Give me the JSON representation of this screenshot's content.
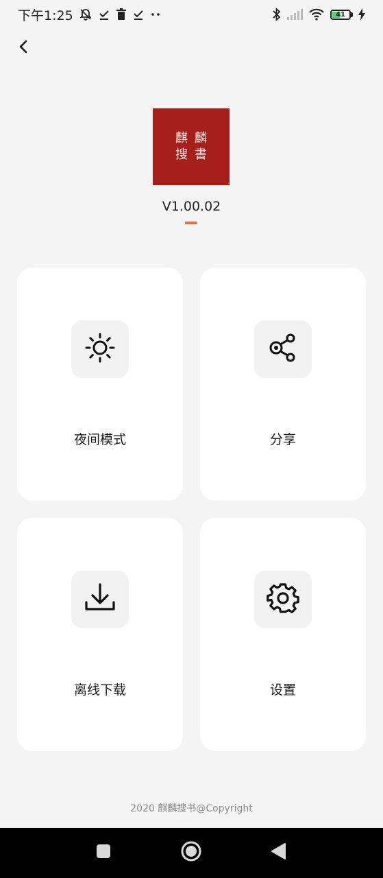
{
  "status_bar": {
    "time": "下午1:25",
    "battery_level": "41",
    "icons_left": [
      "mute-bell-icon",
      "check-icon",
      "trash-icon",
      "check-icon",
      "more-dots-icon"
    ],
    "icons_right": [
      "bluetooth-icon",
      "cell-signal-icon",
      "wifi-icon",
      "battery-icon",
      "charging-icon"
    ]
  },
  "header": {
    "back_icon": "chevron-left-icon"
  },
  "logo": {
    "chars": [
      "麒",
      "麟",
      "搜",
      "書"
    ],
    "background_color": "#a61f1b"
  },
  "version": {
    "text": "V1.00.02",
    "underline_color": "#e8703a"
  },
  "menu": {
    "items": [
      {
        "label": "夜间模式",
        "icon": "sun-icon"
      },
      {
        "label": "分享",
        "icon": "share-icon"
      },
      {
        "label": "离线下载",
        "icon": "download-icon"
      },
      {
        "label": "设置",
        "icon": "gear-icon"
      }
    ]
  },
  "footer": {
    "text": "2020 麒麟搜书@Copyright"
  },
  "nav_bar": {
    "icons": [
      "recents-square-icon",
      "home-circle-icon",
      "back-triangle-icon"
    ]
  }
}
